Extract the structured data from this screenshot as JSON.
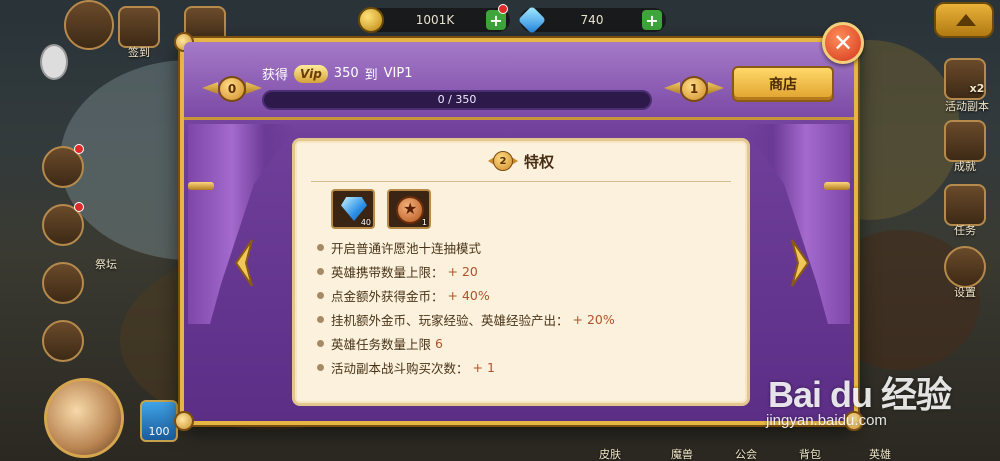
{
  "hud": {
    "gold": "1001K",
    "gems": "740",
    "plus": "+",
    "sign_in": "签到",
    "altar": "祭坛",
    "events_dungeon": "活动副本",
    "x2": "x2",
    "achievements": "成就",
    "tasks": "任务",
    "settings": "设置",
    "level_value": "100",
    "bottom_nav": [
      "皮肤",
      "魔兽",
      "公会",
      "背包",
      "英雄"
    ]
  },
  "vip_modal": {
    "current_level": "0",
    "next_level": "1",
    "gain_prefix": "获得",
    "vip_chip": "Vip",
    "gain_amount": "350",
    "gain_to": "到",
    "gain_target": "VIP1",
    "progress_text": "0 / 350",
    "progress_fraction": 0,
    "shop_label": "商店",
    "close_symbol": "✕",
    "privileges": {
      "badge_level": "2",
      "title": "特权",
      "rewards": [
        {
          "icon": "blue-gem-icon",
          "count": "40"
        },
        {
          "icon": "bronze-star-coin-icon",
          "count": "1"
        }
      ],
      "items": [
        {
          "text": "开启普通许愿池十连抽模式",
          "value": ""
        },
        {
          "text": "英雄携带数量上限：",
          "value": "+ 20"
        },
        {
          "text": "点金额外获得金币：",
          "value": "+ 40%"
        },
        {
          "text": "挂机额外金币、玩家经验、英雄经验产出：",
          "value": "+ 20%"
        },
        {
          "text": "英雄任务数量上限",
          "value": "6"
        },
        {
          "text": "活动副本战斗购买次数：",
          "value": "+ 1"
        }
      ]
    }
  },
  "watermark": {
    "logo": "Bai du 经验",
    "url": "jingyan.baidu.com"
  },
  "colors": {
    "modal_purple": "#6f3f9a",
    "gold_border": "#e7b543",
    "panel_cream": "#fbf1dc",
    "value_orange": "#b0522a",
    "close_red": "#d2381a"
  }
}
